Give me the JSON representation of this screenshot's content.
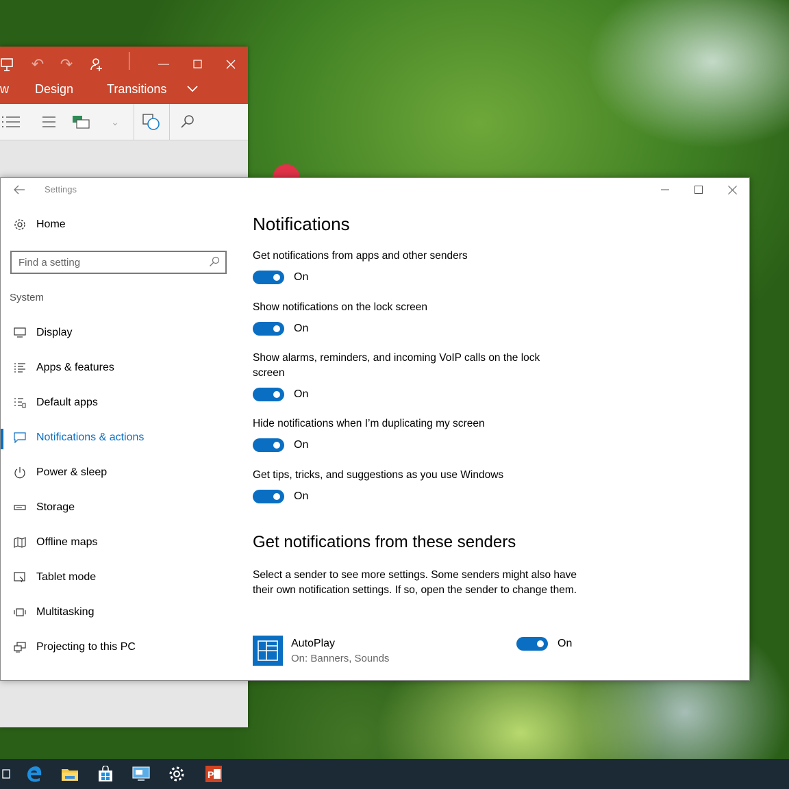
{
  "ppt": {
    "tabs": [
      "w",
      "Design",
      "Transitions"
    ]
  },
  "settings": {
    "title": "Settings",
    "home_label": "Home",
    "search_placeholder": "Find a setting",
    "section_label": "System",
    "nav": [
      {
        "label": "Display",
        "icon": "monitor-icon"
      },
      {
        "label": "Apps & features",
        "icon": "list-icon"
      },
      {
        "label": "Default apps",
        "icon": "default-apps-icon"
      },
      {
        "label": "Notifications & actions",
        "icon": "message-icon",
        "active": true
      },
      {
        "label": "Power & sleep",
        "icon": "power-icon"
      },
      {
        "label": "Storage",
        "icon": "storage-icon"
      },
      {
        "label": "Offline maps",
        "icon": "map-icon"
      },
      {
        "label": "Tablet mode",
        "icon": "tablet-icon"
      },
      {
        "label": "Multitasking",
        "icon": "multitasking-icon"
      },
      {
        "label": "Projecting to this PC",
        "icon": "projecting-icon"
      }
    ],
    "main": {
      "heading": "Notifications",
      "options": [
        {
          "label": "Get notifications from apps and other senders",
          "state": "On"
        },
        {
          "label": "Show notifications on the lock screen",
          "state": "On"
        },
        {
          "label": "Show alarms, reminders, and incoming VoIP calls on the lock screen",
          "state": "On"
        },
        {
          "label": "Hide notifications when I’m duplicating my screen",
          "state": "On"
        },
        {
          "label": "Get tips, tricks, and suggestions as you use Windows",
          "state": "On"
        }
      ],
      "senders_heading": "Get notifications from these senders",
      "senders_desc": "Select a sender to see more settings. Some senders might also have their own notification settings. If so, open the sender to change them.",
      "sender": {
        "name": "AutoPlay",
        "sub": "On: Banners, Sounds",
        "state": "On"
      }
    }
  },
  "colors": {
    "accent": "#0a6fc2",
    "ppt_red": "#c9452b"
  }
}
